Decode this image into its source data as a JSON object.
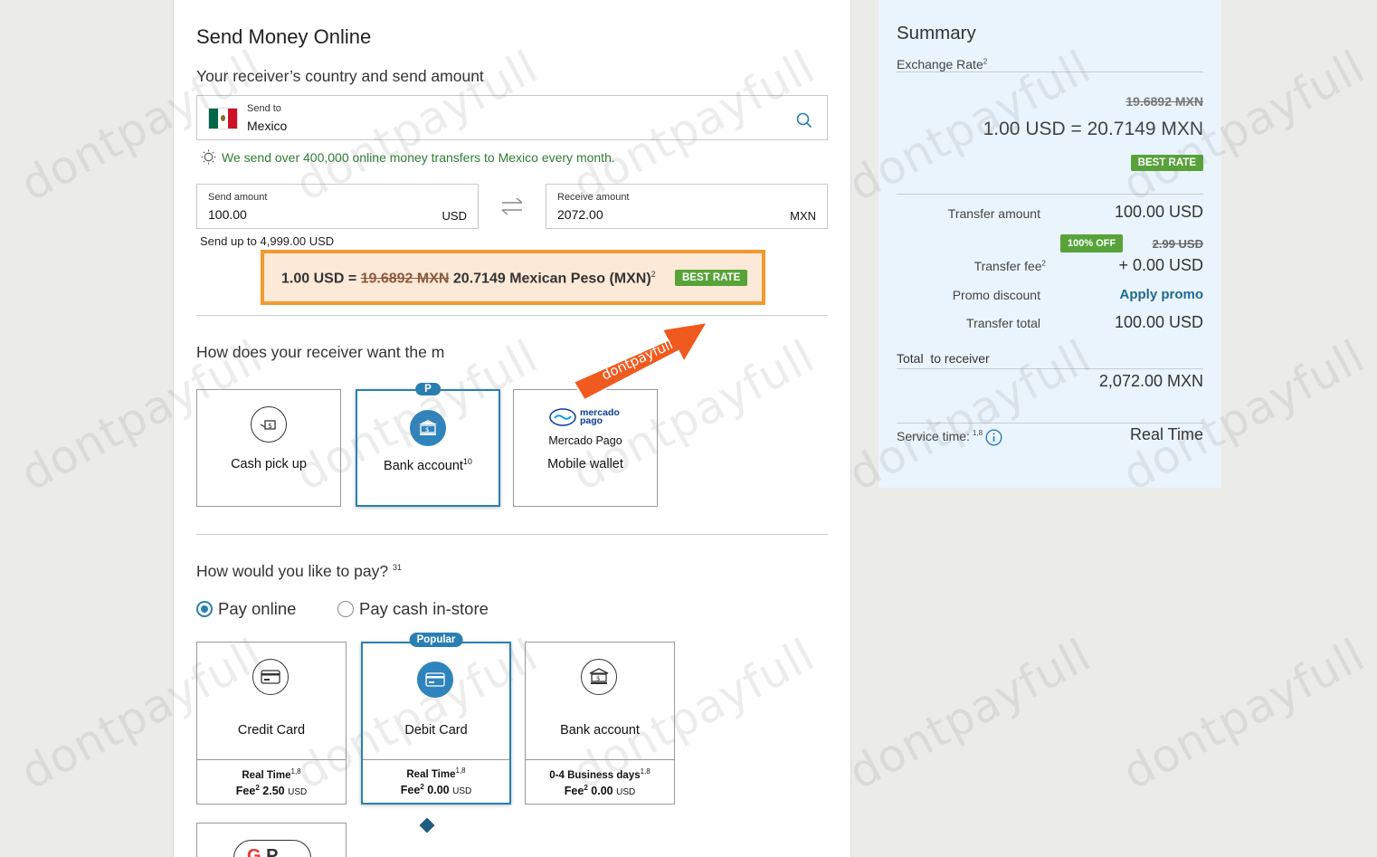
{
  "main": {
    "title": "Send Money Online",
    "country_section_title": "Your receiver’s country and send amount",
    "send_to": {
      "label": "Send to",
      "value": "Mexico"
    },
    "tip": "We send over 400,000 online money transfers to Mexico every month.",
    "send_amount": {
      "label": "Send amount",
      "value": "100.00",
      "currency": "USD"
    },
    "receive_amount": {
      "label": "Receive amount",
      "value": "2072.00",
      "currency": "MXN"
    },
    "send_limit": "Send up to 4,999.00 USD",
    "rate_banner": {
      "prefix": "1.00 USD =",
      "old_rate": "19.6892 MXN",
      "new_rate": "20.7149 Mexican Peso (MXN)",
      "sup": "2",
      "badge": "BEST RATE"
    },
    "receive_method_title": "How does your receiver want the m",
    "arrow_text": "dontpayfull",
    "receive_methods": [
      {
        "label": "Cash pick up",
        "sup": ""
      },
      {
        "label": "Bank account",
        "sup": "10",
        "badge": "P"
      },
      {
        "brand_line1": "mercado",
        "brand_line2": "pago",
        "sublabel": "Mercado Pago",
        "label": "Mobile wallet"
      }
    ],
    "pay_title": "How would you like to pay?",
    "pay_title_sup": "31",
    "pay_options": [
      {
        "label": "Pay online",
        "selected": true
      },
      {
        "label": "Pay cash in-store",
        "selected": false
      }
    ],
    "pay_methods": [
      {
        "label": "Credit Card",
        "time": "Real Time",
        "time_sup": "1,8",
        "fee_label": "Fee",
        "fee_sup": "2",
        "fee": "2.50",
        "fee_cur": "USD"
      },
      {
        "label": "Debit Card",
        "popular": "Popular",
        "time": "Real Time",
        "time_sup": "1,8",
        "fee_label": "Fee",
        "fee_sup": "2",
        "fee": "0.00",
        "fee_cur": "USD"
      },
      {
        "label": "Bank account",
        "time": "0-4 Business days",
        "time_sup": "1,8",
        "fee_label": "Fee",
        "fee_sup": "2",
        "fee": "0.00",
        "fee_cur": "USD"
      }
    ],
    "partial_tile_text": "P"
  },
  "summary": {
    "title": "Summary",
    "exchange_rate_label": "Exchange Rate",
    "exchange_rate_sup": "2",
    "old_rate": "19.6892 MXN",
    "rate": "1.00 USD = 20.7149 MXN",
    "best_rate_badge": "BEST RATE",
    "transfer_amount_label": "Transfer amount",
    "transfer_amount": "100.00 USD",
    "discount_badge": "100% OFF",
    "old_fee": "2.99 USD",
    "transfer_fee_label": "Transfer fee",
    "transfer_fee_sup": "2",
    "transfer_fee": "+ 0.00 USD",
    "promo_label": "Promo discount",
    "promo_link": "Apply promo",
    "transfer_total_label": "Transfer total",
    "transfer_total": "100.00 USD",
    "total_receiver_label": "Total  to receiver",
    "total_receiver": "2,072.00 MXN",
    "service_time_label": "Service time:",
    "service_time_sup": "1,8",
    "service_time": "Real Time"
  },
  "colors": {
    "accent": "#2a7fb1",
    "best_rate": "#57a339",
    "highlight_border": "#f39a2e",
    "tip_green": "#2e7d32"
  },
  "watermark_text": "dontpayfull"
}
